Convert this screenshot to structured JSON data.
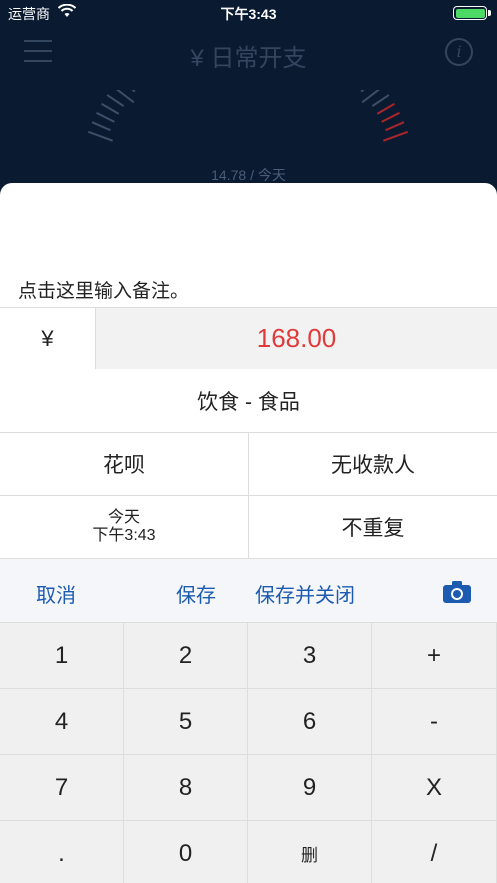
{
  "status_bar": {
    "carrier": "运营商",
    "time": "下午3:43",
    "battery_level": 1.0
  },
  "nav": {
    "title": "¥ 日常开支",
    "info_glyph": "i"
  },
  "dial": {
    "label": "14.78 / 今天"
  },
  "form": {
    "memo_placeholder": "点击这里输入备注。",
    "currency_symbol": "¥",
    "amount": "168.00",
    "category": "饮食 - 食品",
    "payment_method": "花呗",
    "payee": "无收款人",
    "date_day": "今天",
    "date_time": "下午3:43",
    "repeat": "不重复"
  },
  "actions": {
    "cancel": "取消",
    "save": "保存",
    "save_and_close": "保存并关闭",
    "camera_icon": "camera-icon"
  },
  "keypad": {
    "keys": [
      "1",
      "2",
      "3",
      "+",
      "4",
      "5",
      "6",
      "-",
      "7",
      "8",
      "9",
      "X",
      ".",
      "0",
      "删",
      "/"
    ]
  },
  "colors": {
    "header_bg": "#0a1a31",
    "accent": "#1c5bb0",
    "amount": "#e03a3a"
  }
}
